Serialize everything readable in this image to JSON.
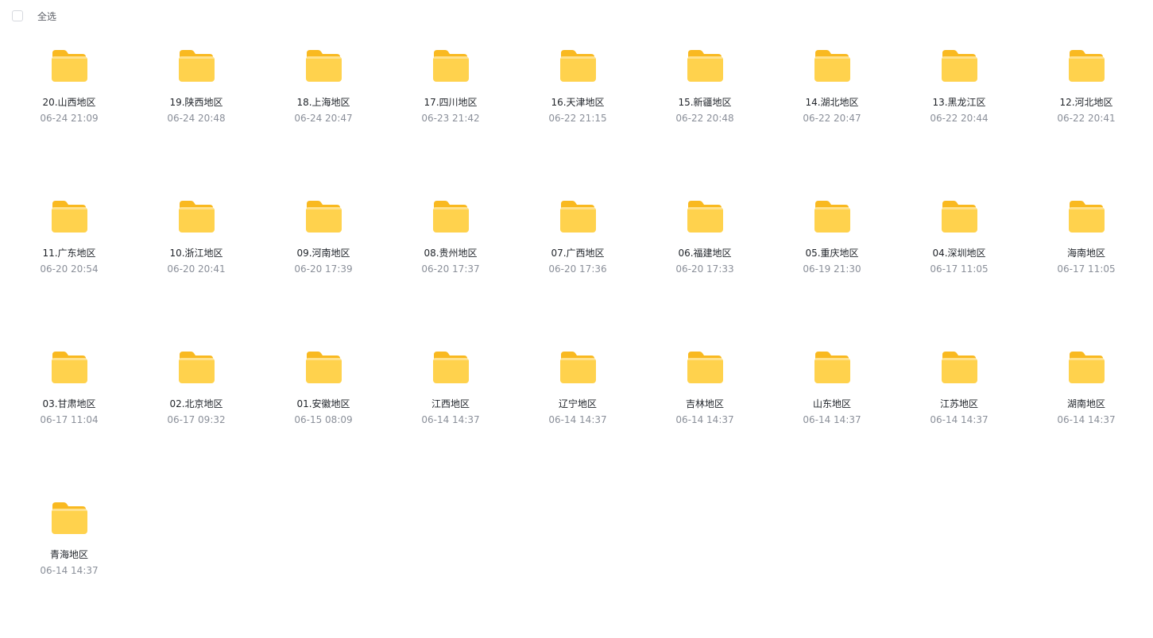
{
  "toolbar": {
    "select_all_label": "全选"
  },
  "colors": {
    "folder_back": "#F9B920",
    "folder_front": "#FFD24D",
    "name_text": "#1f2329",
    "date_text": "#8a8f99"
  },
  "folders": [
    {
      "name": "20.山西地区",
      "date": "06-24 21:09"
    },
    {
      "name": "19.陕西地区",
      "date": "06-24 20:48"
    },
    {
      "name": "18.上海地区",
      "date": "06-24 20:47"
    },
    {
      "name": "17.四川地区",
      "date": "06-23 21:42"
    },
    {
      "name": "16.天津地区",
      "date": "06-22 21:15"
    },
    {
      "name": "15.新疆地区",
      "date": "06-22 20:48"
    },
    {
      "name": "14.湖北地区",
      "date": "06-22 20:47"
    },
    {
      "name": "13.黑龙江区",
      "date": "06-22 20:44"
    },
    {
      "name": "12.河北地区",
      "date": "06-22 20:41"
    },
    {
      "name": "11.广东地区",
      "date": "06-20 20:54"
    },
    {
      "name": "10.浙江地区",
      "date": "06-20 20:41"
    },
    {
      "name": "09.河南地区",
      "date": "06-20 17:39"
    },
    {
      "name": "08.贵州地区",
      "date": "06-20 17:37"
    },
    {
      "name": "07.广西地区",
      "date": "06-20 17:36"
    },
    {
      "name": "06.福建地区",
      "date": "06-20 17:33"
    },
    {
      "name": "05.重庆地区",
      "date": "06-19 21:30"
    },
    {
      "name": "04.深圳地区",
      "date": "06-17 11:05"
    },
    {
      "name": "海南地区",
      "date": "06-17 11:05"
    },
    {
      "name": "03.甘肃地区",
      "date": "06-17 11:04"
    },
    {
      "name": "02.北京地区",
      "date": "06-17 09:32"
    },
    {
      "name": "01.安徽地区",
      "date": "06-15 08:09"
    },
    {
      "name": "江西地区",
      "date": "06-14 14:37"
    },
    {
      "name": "辽宁地区",
      "date": "06-14 14:37"
    },
    {
      "name": "吉林地区",
      "date": "06-14 14:37"
    },
    {
      "name": "山东地区",
      "date": "06-14 14:37"
    },
    {
      "name": "江苏地区",
      "date": "06-14 14:37"
    },
    {
      "name": "湖南地区",
      "date": "06-14 14:37"
    },
    {
      "name": "青海地区",
      "date": "06-14 14:37"
    }
  ]
}
